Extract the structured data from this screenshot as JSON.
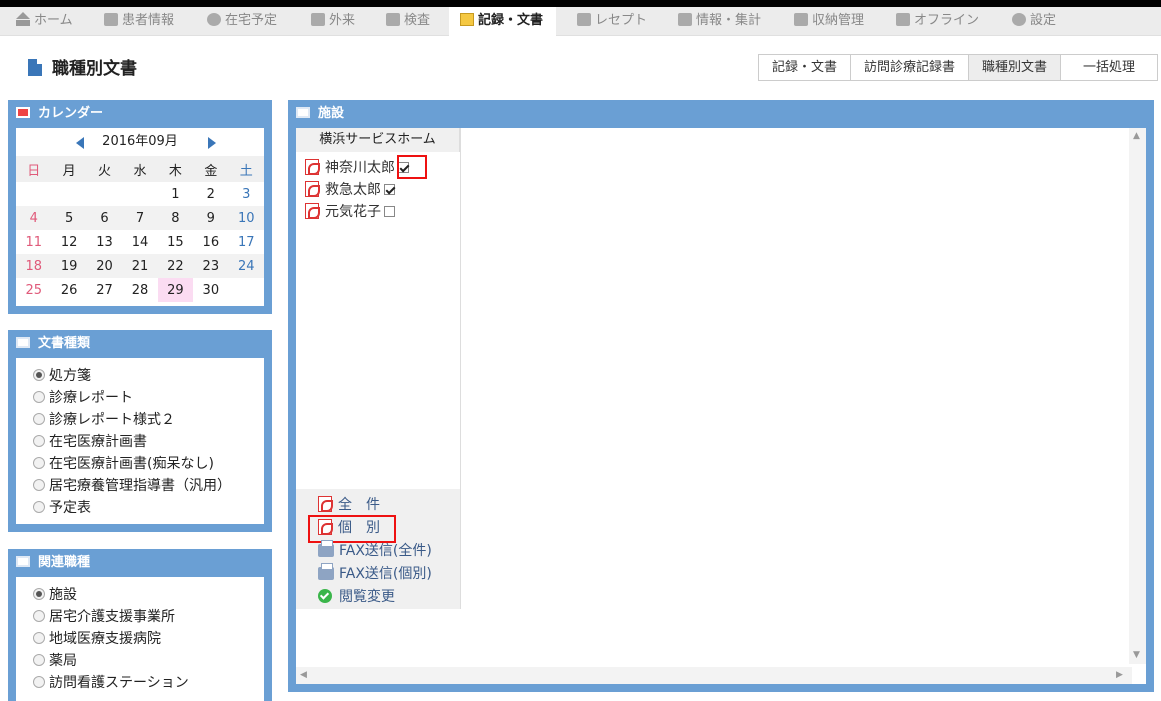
{
  "nav": {
    "items": [
      {
        "label": "ホーム",
        "icon": "home-icon"
      },
      {
        "label": "患者情報",
        "icon": "patient-icon"
      },
      {
        "label": "在宅予定",
        "icon": "clock-icon"
      },
      {
        "label": "外来",
        "icon": "person-icon"
      },
      {
        "label": "検査",
        "icon": "chart-icon"
      },
      {
        "label": "記録・文書",
        "icon": "document-icon"
      },
      {
        "label": "レセプト",
        "icon": "card-icon"
      },
      {
        "label": "情報・集計",
        "icon": "calculator-icon"
      },
      {
        "label": "収納管理",
        "icon": "tag-icon"
      },
      {
        "label": "オフライン",
        "icon": "plug-icon"
      },
      {
        "label": "設定",
        "icon": "gear-icon"
      }
    ],
    "active": "記録・文書"
  },
  "page": {
    "title": "職種別文書"
  },
  "tabs": [
    "記録・文書",
    "訪問診療記録書",
    "職種別文書",
    "一括処理"
  ],
  "calendar": {
    "title": "カレンダー",
    "month_label": "2016年09月",
    "weekdays": [
      "日",
      "月",
      "火",
      "水",
      "木",
      "金",
      "土"
    ],
    "weeks": [
      [
        "",
        "",
        "",
        "",
        "1",
        "2",
        "3"
      ],
      [
        "4",
        "5",
        "6",
        "7",
        "8",
        "9",
        "10"
      ],
      [
        "11",
        "12",
        "13",
        "14",
        "15",
        "16",
        "17"
      ],
      [
        "18",
        "19",
        "20",
        "21",
        "22",
        "23",
        "24"
      ],
      [
        "25",
        "26",
        "27",
        "28",
        "29",
        "30",
        ""
      ]
    ],
    "today": "29"
  },
  "doc_types": {
    "title": "文書種類",
    "options": [
      "処方箋",
      "診療レポート",
      "診療レポート様式２",
      "在宅医療計画書",
      "在宅医療計画書(痴呆なし)",
      "居宅療養管理指導書（汎用）",
      "予定表"
    ],
    "selected": "処方箋"
  },
  "related": {
    "title": "関連職種",
    "options": [
      "施設",
      "居宅介護支援事業所",
      "地域医療支援病院",
      "薬局",
      "訪問看護ステーション"
    ],
    "selected": "施設"
  },
  "facility": {
    "title": "施設",
    "name": "横浜サービスホーム",
    "patients": [
      {
        "name": "神奈川太郎",
        "checked": true
      },
      {
        "name": "救急太郎",
        "checked": true
      },
      {
        "name": "元気花子",
        "checked": false
      }
    ],
    "actions": {
      "all": "全　件",
      "individual": "個　別",
      "fax_all": "FAX送信(全件)",
      "fax_individual": "FAX送信(個別)",
      "view_change": "閲覧変更"
    }
  }
}
